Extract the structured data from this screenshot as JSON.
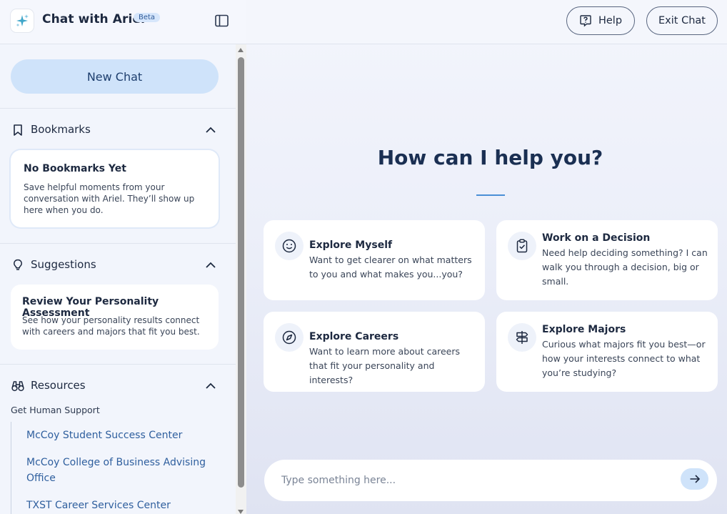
{
  "brand": {
    "title": "Chat with Ariel",
    "badge": "Beta"
  },
  "sidebar": {
    "new_chat_label": "New Chat",
    "bookmarks": {
      "title": "Bookmarks",
      "empty_title": "No Bookmarks Yet",
      "empty_text": "Save helpful moments from your conversation with Ariel. They’ll show up here when you do."
    },
    "suggestions": {
      "title": "Suggestions",
      "items": [
        {
          "title": "Review Your Personality Assessment",
          "text": "See how your personality results connect with careers and majors that fit you best."
        }
      ]
    },
    "resources": {
      "title": "Resources",
      "subheading": "Get Human Support",
      "links": [
        "McCoy Student Success Center",
        "McCoy College of Business Advising Office",
        "TXST Career Services Center"
      ]
    }
  },
  "header": {
    "help_label": "Help",
    "exit_label": "Exit Chat"
  },
  "main": {
    "heading": "How can I help you?",
    "tiles": [
      {
        "title": "Explore Myself",
        "text": "Want to get clearer on what matters to you and what makes you...you?",
        "icon": "smile-icon"
      },
      {
        "title": "Work on a Decision",
        "text": "Need help deciding something? I can walk you through a decision, big or small.",
        "icon": "clipboard-check-icon"
      },
      {
        "title": "Explore Careers",
        "text": "Want to learn more about careers that fit your personality and interests?",
        "icon": "compass-icon"
      },
      {
        "title": "Explore Majors",
        "text": "Curious what majors fit you best—or how your interests connect to what you’re studying?",
        "icon": "signpost-icon"
      }
    ],
    "composer": {
      "placeholder": "Type something here...",
      "value": ""
    }
  },
  "colors": {
    "accent": "#cfe3fa",
    "link": "#2f5f9e",
    "heading": "#1a2f52",
    "rule": "#4a8fd6"
  }
}
